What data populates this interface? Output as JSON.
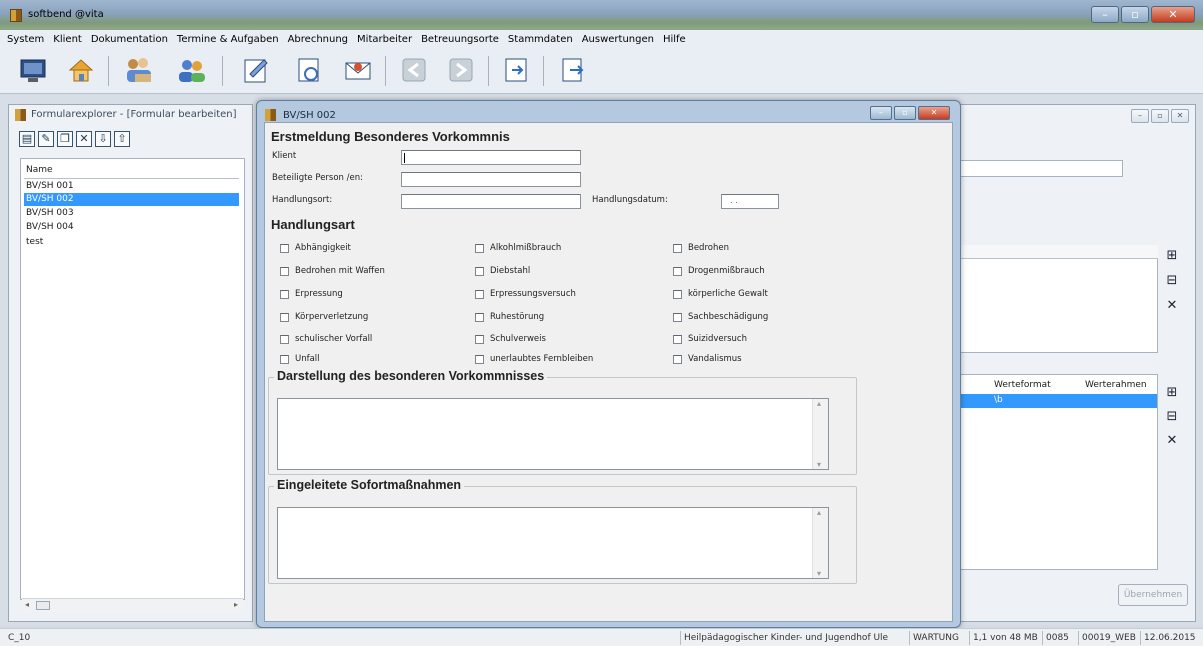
{
  "app": {
    "title": "softbend @vita"
  },
  "menu": [
    "System",
    "Klient",
    "Dokumentation",
    "Termine & Aufgaben",
    "Abrechnung",
    "Mitarbeiter",
    "Betreuungsorte",
    "Stammdaten",
    "Auswertungen",
    "Hilfe"
  ],
  "toolbar": [
    "monitor-icon",
    "home-icon",
    "group-icon",
    "users-icon",
    "edit-form-icon",
    "refresh-icon",
    "mail-icon",
    "back-icon",
    "forward-icon",
    "export-icon",
    "print-icon"
  ],
  "explorer": {
    "title": "Formularexplorer - [Formular bearbeiten]",
    "column_header": "Name",
    "rows": [
      "BV/SH 001",
      "BV/SH 002",
      "BV/SH 003",
      "BV/SH 004",
      "test"
    ],
    "selected_index": 1
  },
  "right_window": {
    "col_werteformat": "Werteformat",
    "col_werterahmen": "Werterahmen",
    "sel_value": "\\b",
    "accept_button": "Übernehmen"
  },
  "dialog": {
    "title": "BV/SH 002",
    "heading": "Erstmeldung Besonderes Vorkommnis",
    "klient_label": "Klient",
    "beteiligte_label": "Beteiligte Person /en:",
    "handlungsort_label": "Handlungsort:",
    "handlungsdatum_label": "Handlungsdatum:",
    "handlungsdatum_value": ". .",
    "handlungsart_heading": "Handlungsart",
    "checkboxes": [
      [
        "Abhängigkeit",
        "Alkohlmißbrauch",
        "Bedrohen"
      ],
      [
        "Bedrohen mit Waffen",
        "Diebstahl",
        "Drogenmißbrauch"
      ],
      [
        "Erpressung",
        "Erpressungsversuch",
        "körperliche Gewalt"
      ],
      [
        "Körperverletzung",
        "Ruhestörung",
        "Sachbeschädigung"
      ],
      [
        "schulischer Vorfall",
        "Schulverweis",
        "Suizidversuch"
      ],
      [
        "Unfall",
        "unerlaubtes Fernbleiben",
        "Vandalismus"
      ]
    ],
    "group1_title": "Darstellung des besonderen Vorkommnisses",
    "group2_title": "Eingeleitete Sofortmaßnahmen"
  },
  "status": {
    "left": "C_10",
    "cells": [
      "Heilpädagogischer Kinder- und Jugendhof Ule",
      "WARTUNG",
      "1,1 von 48 MB",
      "0085",
      "00019_WEB",
      "12.06.2015"
    ]
  }
}
